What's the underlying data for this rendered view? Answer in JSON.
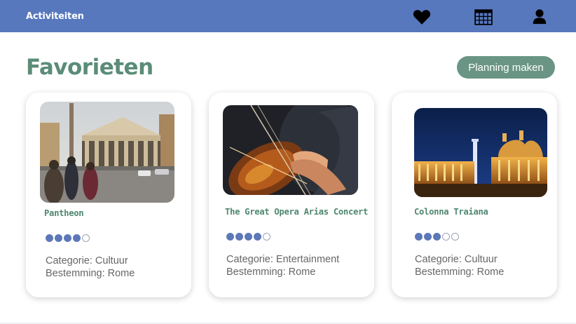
{
  "header": {
    "title": "Activiteiten",
    "icons": [
      "heart-icon",
      "calendar-icon",
      "user-icon"
    ]
  },
  "page": {
    "title": "Favorieten",
    "plan_button": "Planning maken"
  },
  "rating_max": 5,
  "cards": [
    {
      "title": "Pantheon",
      "rating": 4,
      "category": "Categorie: Cultuur",
      "destination": "Bestemming: Rome",
      "image": "pantheon-photo"
    },
    {
      "title": "The Great Opera Arias Concert",
      "rating": 4,
      "category": "Categorie: Entertainment",
      "destination": "Bestemming: Rome",
      "image": "violin-concert-photo"
    },
    {
      "title": "Colonna Traiana",
      "rating": 3,
      "category": "Categorie: Cultuur",
      "destination": "Bestemming: Rome",
      "image": "colonna-traiana-night-photo"
    }
  ],
  "colors": {
    "header": "#5878be",
    "accent_green": "#5b8c78",
    "button": "#6a9585",
    "rating_on": "#5c78b8"
  }
}
